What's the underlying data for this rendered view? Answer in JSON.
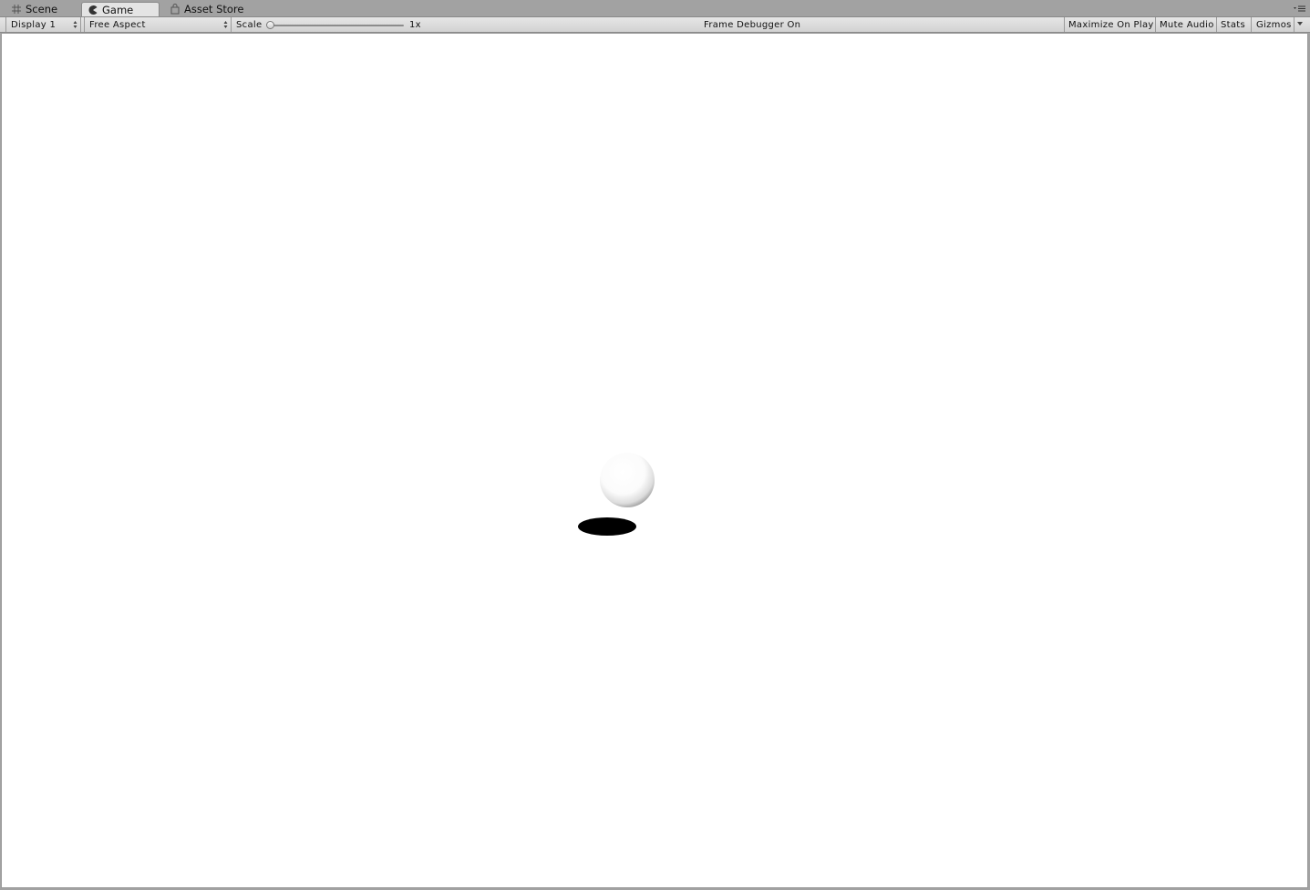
{
  "tabs": [
    {
      "label": "Scene",
      "icon": "scene-grid-icon",
      "active": false
    },
    {
      "label": "Game",
      "icon": "game-pacman-icon",
      "active": true
    },
    {
      "label": "Asset Store",
      "icon": "asset-store-bag-icon",
      "active": false
    }
  ],
  "toolbar": {
    "display_label": "Display 1",
    "aspect_label": "Free Aspect",
    "scale_label": "Scale",
    "scale_value": "1x",
    "scale_fraction": 0.0,
    "status_text": "Frame Debugger On",
    "maximize_label": "Maximize On Play",
    "mute_label": "Mute Audio",
    "stats_label": "Stats",
    "gizmos_label": "Gizmos"
  },
  "colors": {
    "chrome": "#a2a2a2",
    "toolbar": "#dcdcdc",
    "viewport_background": "#ffffff",
    "shadow": "#000000"
  }
}
